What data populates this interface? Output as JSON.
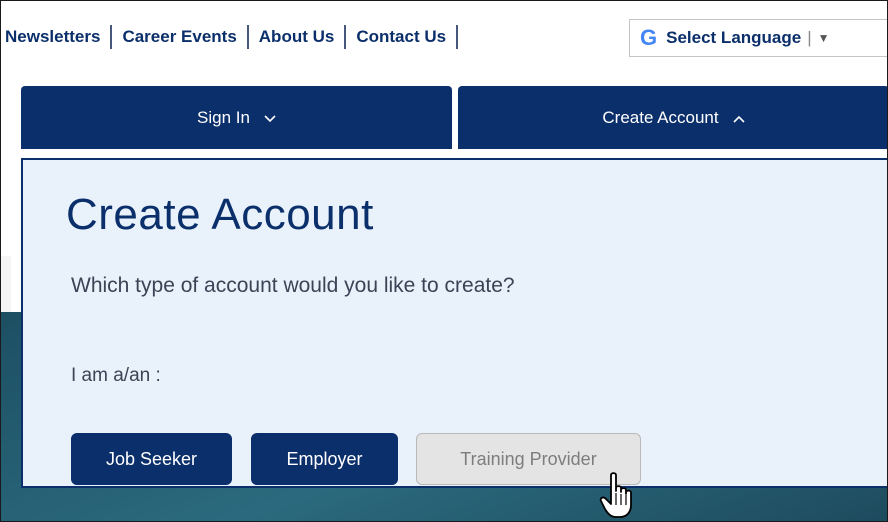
{
  "topnav": {
    "links": [
      "Newsletters",
      "Career Events",
      "About Us",
      "Contact Us"
    ],
    "language": {
      "g_glyph": "G",
      "label": "Select Language",
      "separator": "|",
      "arrow": "▼"
    }
  },
  "account_bars": {
    "sign_in": {
      "label": "Sign In",
      "chevron": "⌄"
    },
    "create": {
      "label": "Create Account",
      "chevron": "^"
    }
  },
  "panel": {
    "title": "Create Account",
    "question": "Which type of account would you like to create?",
    "prompt": "I am a/an :",
    "buttons": {
      "job_seeker": "Job Seeker",
      "employer": "Employer",
      "training_provider": "Training Provider"
    }
  },
  "colors": {
    "brand_navy": "#0b2f6b",
    "panel_bg": "#e9f2fb",
    "disabled_bg": "#e4e4e4"
  }
}
